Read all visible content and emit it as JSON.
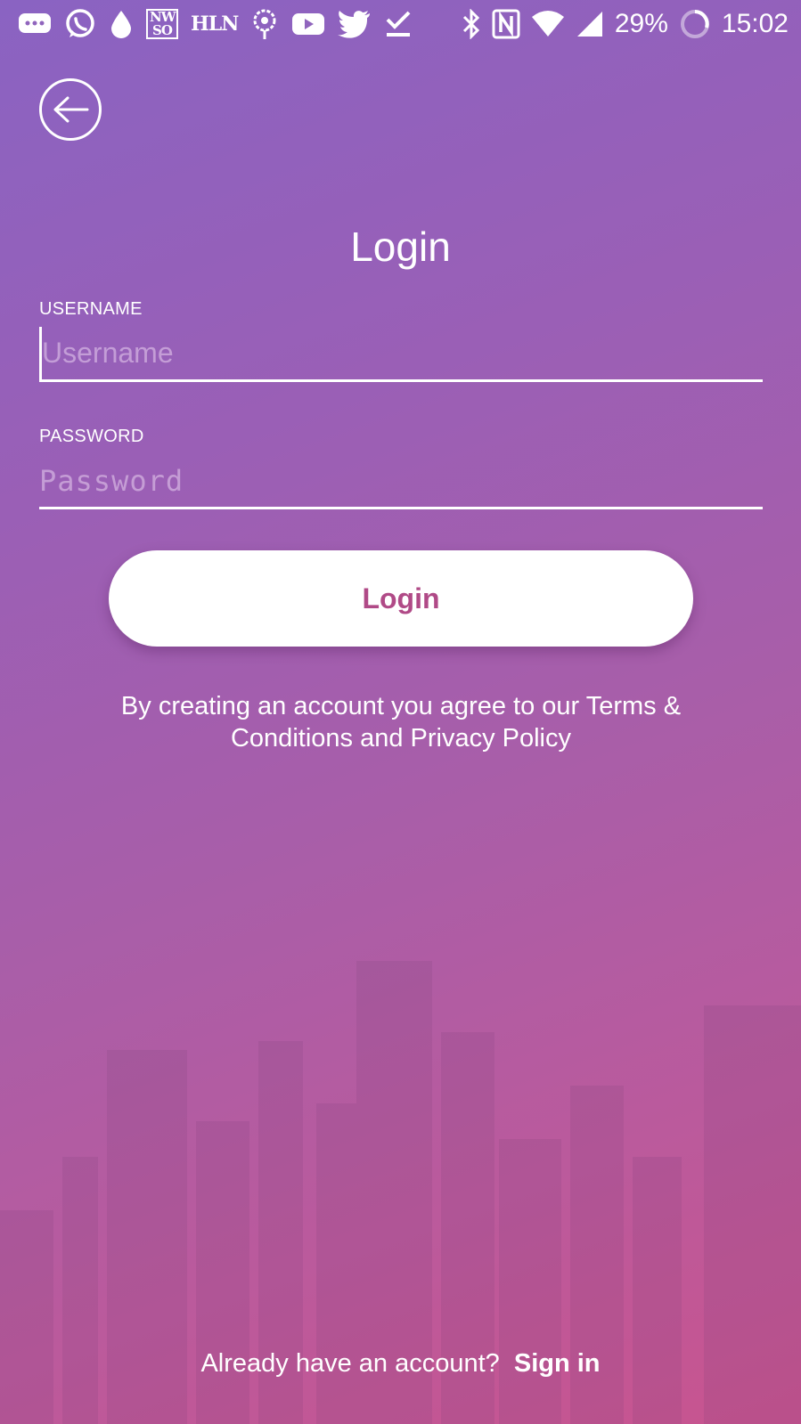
{
  "status_bar": {
    "left_icons": [
      "messages-icon",
      "whatsapp-icon",
      "drop-icon",
      "nws-icon",
      "hln-icon",
      "flower-icon",
      "youtube-icon",
      "twitter-icon",
      "download-done-icon"
    ],
    "nws_text": "NW SO",
    "hln_text": "HLN",
    "battery": "29%",
    "time": "15:02"
  },
  "page": {
    "title": "Login"
  },
  "username": {
    "label": "USERNAME",
    "placeholder": "Username",
    "value": ""
  },
  "password": {
    "label": "PASSWORD",
    "placeholder": "Password",
    "value": ""
  },
  "login_button": {
    "label": "Login",
    "text_color": "#b04a87"
  },
  "terms": {
    "text": "By creating an account you agree to our Terms & Conditions and Privacy Policy"
  },
  "footer": {
    "prompt": "Already have an account?",
    "link": "Sign in"
  },
  "colors": {
    "gradient_start": "#8a63c2",
    "gradient_end": "#c8548f"
  }
}
